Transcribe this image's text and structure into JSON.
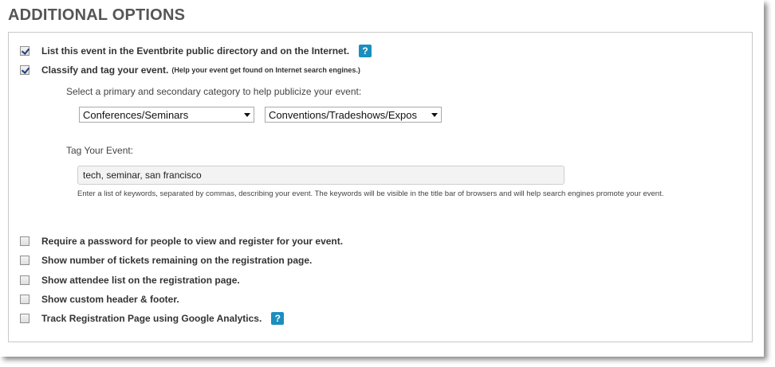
{
  "section": {
    "title": "ADDITIONAL OPTIONS"
  },
  "options": {
    "list_public": {
      "label": "List this event in the Eventbrite public directory and on the Internet.",
      "checked": true,
      "help_glyph": "?"
    },
    "classify": {
      "label": "Classify and tag your event.",
      "hint": "(Help your event get found on Internet search engines.)",
      "checked": true
    },
    "password": {
      "label": "Require a password for people to view and register for your event.",
      "checked": false
    },
    "tickets_remaining": {
      "label": "Show number of tickets remaining on the registration page.",
      "checked": false
    },
    "attendee_list": {
      "label": "Show attendee list on the registration page.",
      "checked": false
    },
    "header_footer": {
      "label": "Show custom header & footer.",
      "checked": false
    },
    "analytics": {
      "label": "Track Registration Page using Google Analytics.",
      "checked": false,
      "help_glyph": "?"
    }
  },
  "category": {
    "prompt": "Select a primary and secondary category to help publicize your event:",
    "primary_value": "Conferences/Seminars",
    "secondary_value": "Conventions/Tradeshows/Expos"
  },
  "tags": {
    "label": "Tag Your Event:",
    "value": "tech, seminar, san francisco",
    "help_text": "Enter a list of keywords, separated by commas, describing your event. The keywords will be visible in the title bar of browsers and will help search engines promote your event."
  },
  "colors": {
    "heading": "#555555",
    "help_badge": "#1a8fbf",
    "checkmark": "#1e3c7a",
    "panel_border": "#c8c8c8"
  }
}
